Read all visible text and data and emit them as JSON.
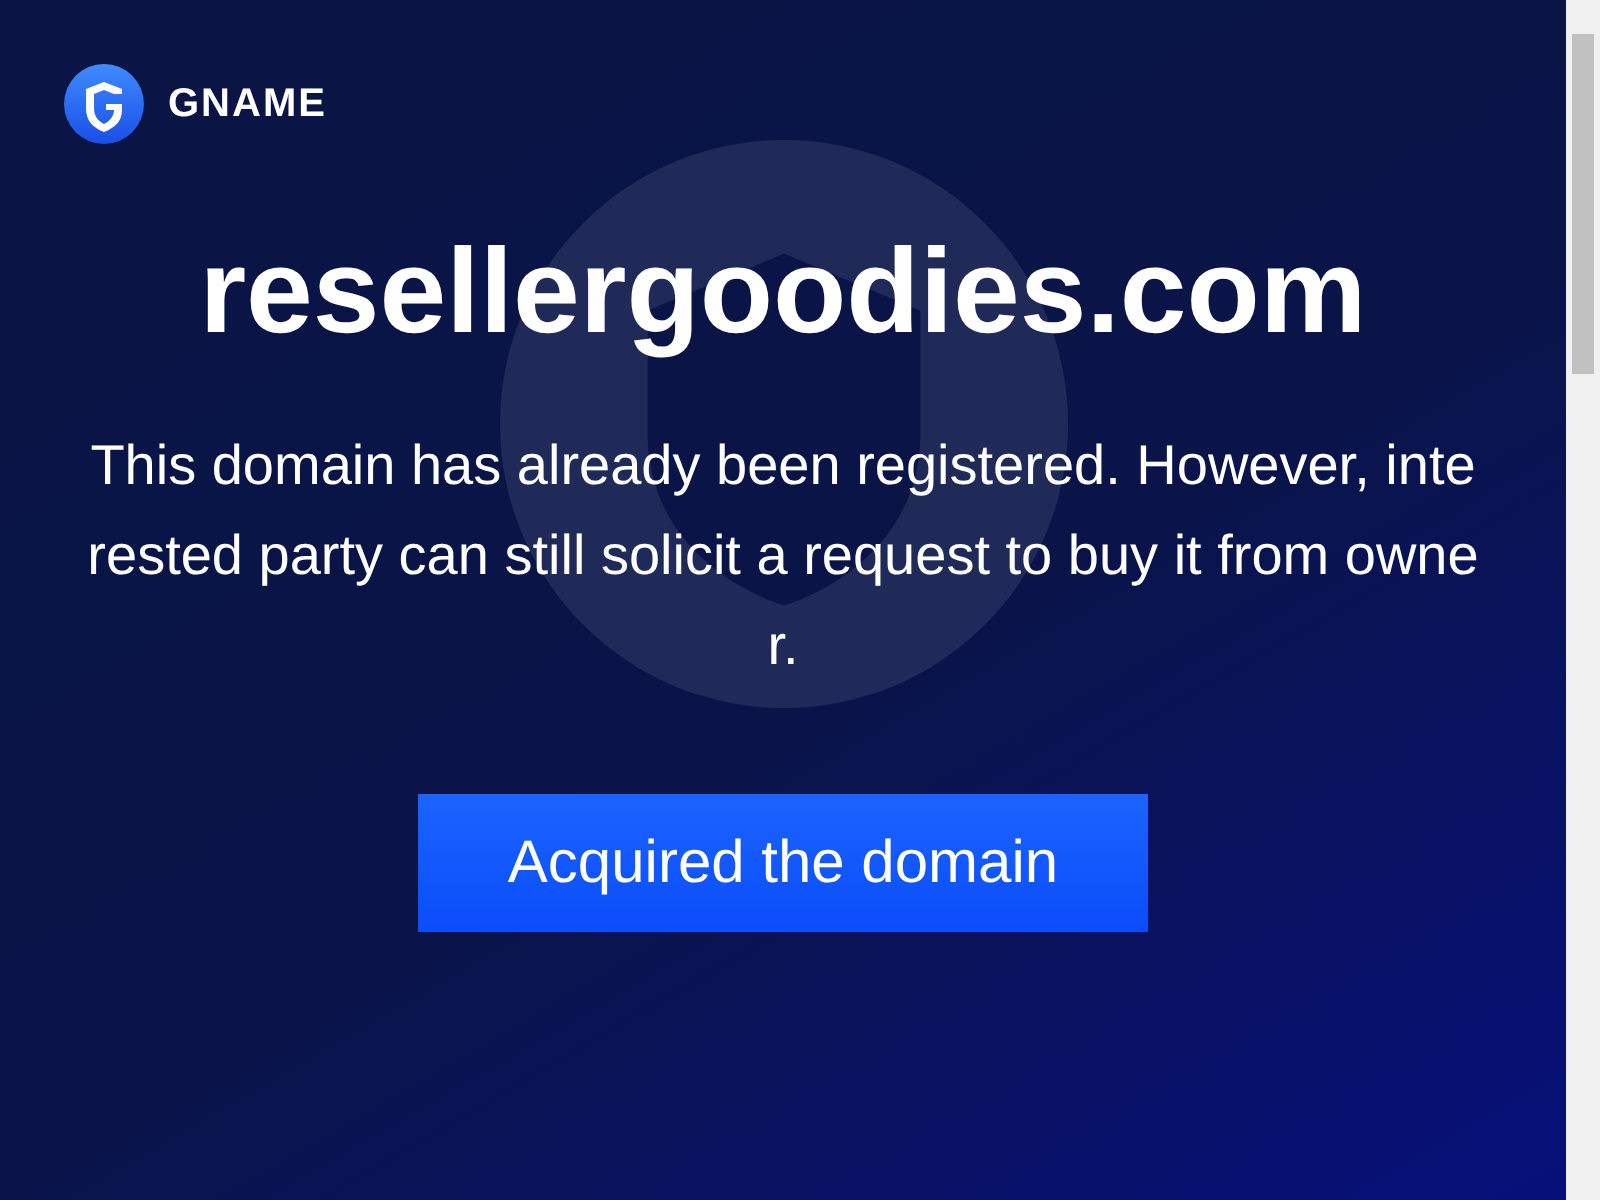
{
  "header": {
    "brand": "GNAME"
  },
  "hero": {
    "domain": "resellergoodies.com",
    "message": "This domain has already been registered. However, interested party can still solicit a request to buy it from owner.",
    "button": "Acquired the domain"
  }
}
